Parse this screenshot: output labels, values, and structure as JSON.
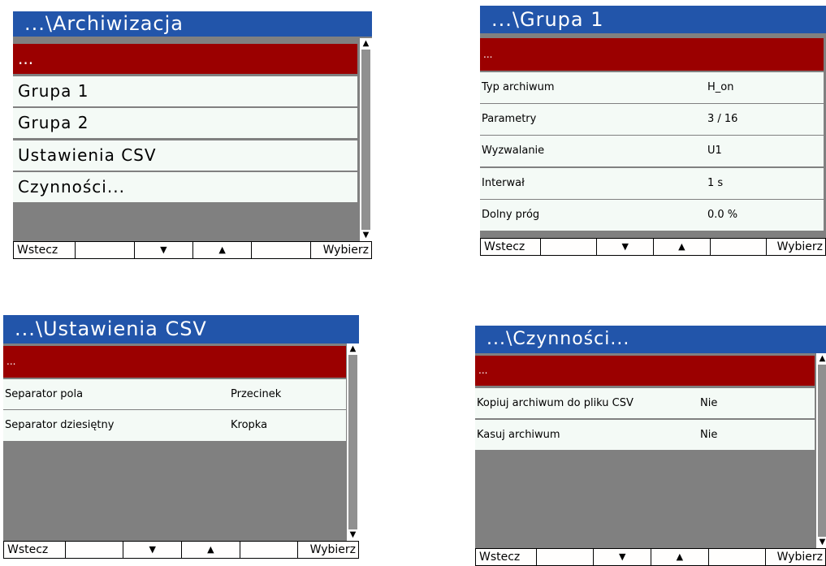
{
  "colors": {
    "title_bar": "#2255aa",
    "selected_row": "#9b0000",
    "row_background": "#f4faf6",
    "screen_background": "#808080"
  },
  "screens": [
    {
      "title": "...\\Archiwizacja",
      "rows": [
        {
          "label": "...",
          "value": "",
          "selected": true
        },
        {
          "label": "Grupa 1",
          "value": ""
        },
        {
          "label": "Grupa 2",
          "value": ""
        },
        {
          "label": "Ustawienia CSV",
          "value": ""
        },
        {
          "label": "Czynności...",
          "value": ""
        }
      ],
      "buttons": [
        "Wstecz",
        "",
        "▼",
        "▲",
        "",
        "Wybierz"
      ]
    },
    {
      "title": "...\\Grupa 1",
      "rows": [
        {
          "label": "...",
          "value": "",
          "selected": true
        },
        {
          "label": "Typ archiwum",
          "value": "H_on"
        },
        {
          "label": "Parametry",
          "value": "3 / 16"
        },
        {
          "label": "Wyzwalanie",
          "value": "U1"
        },
        {
          "label": "Interwał",
          "value": "1 s"
        },
        {
          "label": "Dolny próg",
          "value": "0.0 %"
        }
      ],
      "buttons": [
        "Wstecz",
        "",
        "▼",
        "▲",
        "",
        "Wybierz"
      ]
    },
    {
      "title": "...\\Ustawienia CSV",
      "rows": [
        {
          "label": "...",
          "value": "",
          "selected": true
        },
        {
          "label": "Separator pola",
          "value": "Przecinek"
        },
        {
          "label": "Separator dziesiętny",
          "value": "Kropka"
        }
      ],
      "buttons": [
        "Wstecz",
        "",
        "▼",
        "▲",
        "",
        "Wybierz"
      ]
    },
    {
      "title": "...\\Czynności...",
      "rows": [
        {
          "label": "...",
          "value": "",
          "selected": true
        },
        {
          "label": "Kopiuj archiwum do pliku CSV",
          "value": "Nie"
        },
        {
          "label": "Kasuj archiwum",
          "value": "Nie"
        }
      ],
      "buttons": [
        "Wstecz",
        "",
        "▼",
        "▲",
        "",
        "Wybierz"
      ]
    }
  ]
}
